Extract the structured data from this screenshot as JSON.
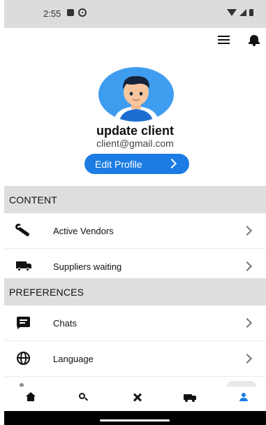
{
  "status_bar": {
    "time": "2:55",
    "left_icons": [
      "sd-card-icon",
      "gps-icon"
    ],
    "right_icons": [
      "wifi-icon",
      "signal-icon",
      "battery-icon"
    ]
  },
  "topbar": {
    "icons": [
      "menu-icon",
      "bell-icon"
    ]
  },
  "profile": {
    "name": "update client",
    "email": "client@gmail.com",
    "edit_button_label": "Edit Profile",
    "avatar_bg": "#3f9df0"
  },
  "sections": [
    {
      "title": "CONTENT",
      "items": [
        {
          "label": "Active Vendors",
          "icon": "wrench-icon"
        },
        {
          "label": "Suppliers waiting",
          "icon": "truck-icon"
        }
      ]
    },
    {
      "title": "PREFERENCES",
      "items": [
        {
          "label": "Chats",
          "icon": "chat-icon"
        },
        {
          "label": "Language",
          "icon": "globe-icon"
        }
      ]
    }
  ],
  "bottom_nav": {
    "items": [
      {
        "icon": "home-icon"
      },
      {
        "icon": "search-icon"
      },
      {
        "icon": "tools-icon"
      },
      {
        "icon": "truck-icon"
      },
      {
        "icon": "person-icon",
        "active": true
      }
    ]
  },
  "colors": {
    "accent": "#1c7ce3",
    "section_bg": "#dedede",
    "status_bg": "#dcdcdc"
  }
}
